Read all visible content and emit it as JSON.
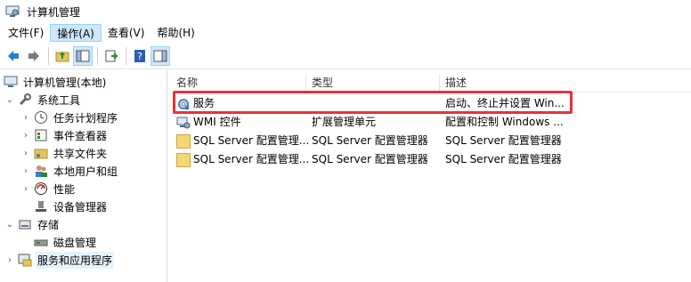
{
  "window": {
    "title": "计算机管理"
  },
  "menubar": {
    "items": [
      "文件(F)",
      "操作(A)",
      "查看(V)",
      "帮助(H)"
    ],
    "active_index": 1
  },
  "toolbar": {
    "buttons": [
      "back-arrow-icon",
      "forward-arrow-icon",
      "up-folder-icon",
      "show-hide-tree-icon",
      "export-list-icon",
      "help-icon",
      "action-pane-icon"
    ]
  },
  "tree": {
    "root": "计算机管理(本地)",
    "system_tools": "系统工具",
    "task_scheduler": "任务计划程序",
    "event_viewer": "事件查看器",
    "shared_folders": "共享文件夹",
    "local_users": "本地用户和组",
    "performance": "性能",
    "device_manager": "设备管理器",
    "storage": "存储",
    "disk_management": "磁盘管理",
    "services_apps": "服务和应用程序"
  },
  "list": {
    "headers": {
      "name": "名称",
      "type": "类型",
      "desc": "描述"
    },
    "rows": [
      {
        "name": "服务",
        "type": "",
        "desc": "启动、终止并设置 Win...",
        "icon": "gear-icon"
      },
      {
        "name": "WMI 控件",
        "type": "扩展管理单元",
        "desc": "配置和控制 Windows ...",
        "icon": "wmi-icon"
      },
      {
        "name": "SQL Server 配置管理...",
        "type": "SQL Server 配置管理器",
        "desc": "SQL Server 配置管理器",
        "icon": "folder-icon"
      },
      {
        "name": "SQL Server 配置管理...",
        "type": "SQL Server 配置管理器",
        "desc": "SQL Server 配置管理器",
        "icon": "folder-icon"
      }
    ]
  },
  "colors": {
    "highlight": "#e8313a",
    "selection": "#cce8ff"
  }
}
